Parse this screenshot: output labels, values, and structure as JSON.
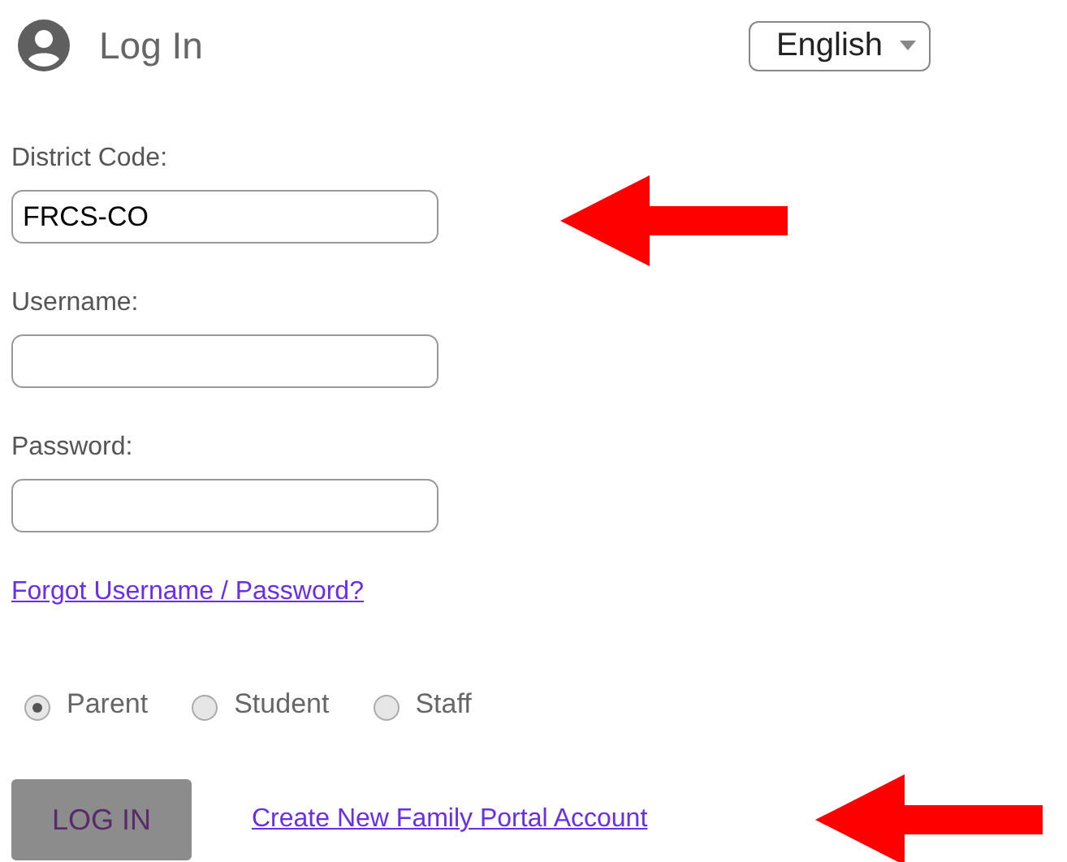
{
  "header": {
    "title": "Log In",
    "language": "English"
  },
  "fields": [
    {
      "label": "District Code:",
      "value": "FRCS-CO"
    },
    {
      "label": "Username:"
    },
    {
      "label": "Password:"
    }
  ],
  "forgot_link": "Forgot Username / Password?",
  "roles": [
    {
      "label": "Parent",
      "selected": true
    },
    {
      "label": "Student",
      "selected": false
    },
    {
      "label": "Staff",
      "selected": false
    }
  ],
  "login_button": "LOG IN",
  "create_link": "Create New Family Portal Account"
}
